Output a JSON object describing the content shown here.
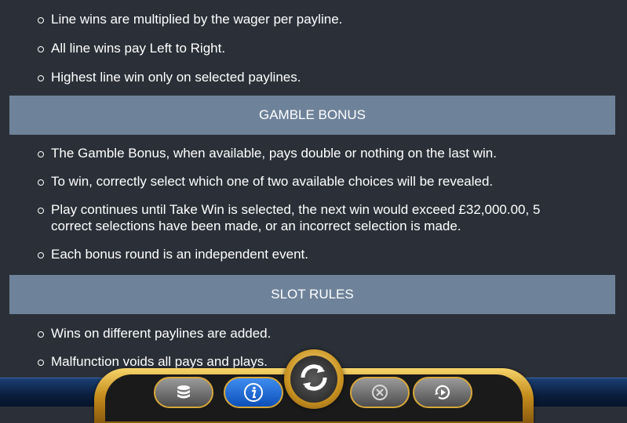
{
  "line_rules": [
    "Line wins are multiplied by the wager per payline.",
    "All line wins pay Left to Right.",
    "Highest line win only on selected paylines."
  ],
  "gamble": {
    "heading": "GAMBLE BONUS",
    "rules": [
      "The Gamble Bonus, when available, pays double or nothing on the last win.",
      "To win, correctly select which one of two available choices will be revealed.",
      "Play continues until Take Win is selected, the next win would exceed £32,000.00, 5 correct selections have been made, or an incorrect selection is made.",
      "Each bonus round is an independent event."
    ]
  },
  "slot": {
    "heading": "SLOT RULES",
    "rules": [
      "Wins on different paylines are added.",
      "Malfunction voids all pays and plays."
    ]
  },
  "controls": {
    "icons": [
      "coins-icon",
      "info-icon",
      "spin-icon",
      "stop-icon",
      "autoplay-icon"
    ]
  },
  "colors": {
    "background": "#2b3038",
    "section_header": "#6e839a",
    "info_button": "#1f6fe0",
    "gold_frame": "#d9a532"
  }
}
